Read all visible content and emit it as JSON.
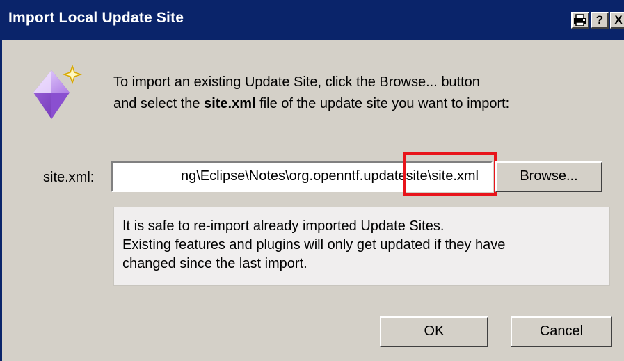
{
  "window": {
    "title": "Import Local Update Site",
    "controls": {
      "print": "⎙",
      "help": "?",
      "close": "X"
    }
  },
  "intro": {
    "line1": "To import an existing Update Site, click the Browse... button",
    "line2_before": "and select the ",
    "line2_bold": "site.xml",
    "line2_after": " file of the update site you want to import:"
  },
  "site_field": {
    "label": "site.xml:",
    "value": "ng\\Eclipse\\Notes\\org.openntf.updatesite\\site.xml"
  },
  "buttons": {
    "browse": "Browse...",
    "ok": "OK",
    "cancel": "Cancel"
  },
  "info": {
    "line1": "It is safe to re-import already imported Update Sites.",
    "line2": "Existing features and plugins will only get updated if they have",
    "line3": "changed since the last import."
  },
  "colors": {
    "titlebar": "#0a246a",
    "dialog": "#d4d0c8",
    "highlight": "#e8141b"
  },
  "icons": {
    "wizard": "diamond-sparkle-icon"
  }
}
